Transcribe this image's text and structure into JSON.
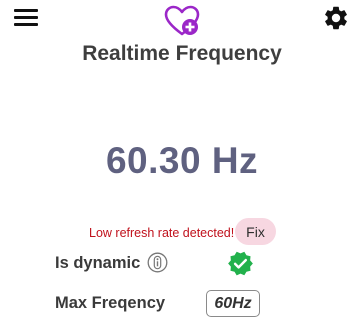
{
  "app": {
    "title": "Realtime Frequency",
    "accent_color": "#9b27c8",
    "icons": {
      "menu": "menu-icon",
      "logo": "heart-plus-icon",
      "settings": "gear-icon",
      "info": "info-icon",
      "verified": "verified-check-icon"
    }
  },
  "display": {
    "frequency": "60.30 Hz",
    "frequency_color": "#5f6180"
  },
  "warning": {
    "text": "Low refresh rate detected!",
    "color": "#c0111c",
    "fix_label": "Fix"
  },
  "rows": {
    "dynamic_label": "Is dynamic",
    "dynamic_status_color": "#22b14c",
    "max_label": "Max Freqency",
    "max_value": "60Hz"
  }
}
